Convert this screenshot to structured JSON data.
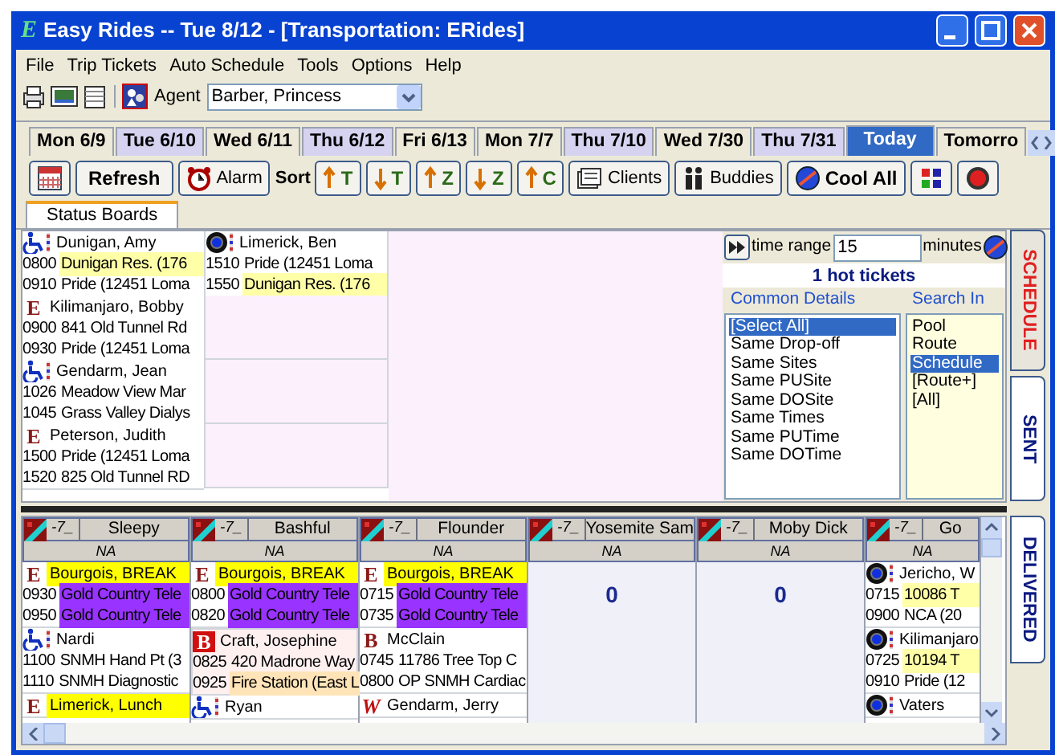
{
  "window": {
    "logo": "E",
    "title": "Easy Rides -- Tue 8/12 - [Transportation: ERides]"
  },
  "menu": [
    "File",
    "Trip Tickets",
    "Auto Schedule",
    "Tools",
    "Options",
    "Help"
  ],
  "agent": {
    "label": "Agent",
    "value": "Barber, Princess"
  },
  "date_tabs": [
    {
      "label": "Mon 6/9",
      "selected": false,
      "color": "#ece9d8"
    },
    {
      "label": "Tue 6/10",
      "selected": false,
      "color": "#d6d3f0"
    },
    {
      "label": "Wed 6/11",
      "selected": false,
      "color": "#ece9d8"
    },
    {
      "label": "Thu 6/12",
      "selected": false,
      "color": "#d6d3f0"
    },
    {
      "label": "Fri 6/13",
      "selected": false,
      "color": "#ece9d8"
    },
    {
      "label": "Mon 7/7",
      "selected": false,
      "color": "#ece9d8"
    },
    {
      "label": "Thu 7/10",
      "selected": false,
      "color": "#d6d3f0"
    },
    {
      "label": "Wed 7/30",
      "selected": false,
      "color": "#ece9d8"
    },
    {
      "label": "Thu 7/31",
      "selected": false,
      "color": "#d6d3f0"
    },
    {
      "label": "Today",
      "selected": true,
      "color": "#316ac5"
    },
    {
      "label": "Tomorro",
      "selected": false,
      "color": "#ece9d8"
    }
  ],
  "toolbar": {
    "refresh": "Refresh",
    "alarm": "Alarm",
    "sort_label": "Sort",
    "sort_buttons": [
      {
        "kind": "up",
        "letter": "T"
      },
      {
        "kind": "down",
        "letter": "T"
      },
      {
        "kind": "up",
        "letter": "Z"
      },
      {
        "kind": "down",
        "letter": "Z"
      },
      {
        "kind": "up",
        "letter": "C"
      }
    ],
    "clients": "Clients",
    "buddies": "Buddies",
    "cool_all": "Cool All"
  },
  "page_tab": "Status Boards",
  "hot_board": {
    "rows": [
      [
        {
          "name": "Dunigan, Amy",
          "kind": "wheelchair",
          "stops": [
            {
              "time": "0800",
              "place": "Dunigan Res. (176",
              "color": "#ffffa8"
            },
            {
              "time": "0910",
              "place": "Pride (12451 Loma"
            }
          ]
        },
        {
          "name": "Limerick, Ben",
          "kind": "target",
          "stops": [
            {
              "time": "1510",
              "place": "Pride (12451 Loma"
            },
            {
              "time": "1550",
              "place": "Dunigan Res. (176",
              "color": "#ffffa8"
            }
          ]
        }
      ],
      [
        {
          "name": "Kilimanjaro, Bobby",
          "kind": "letter",
          "letter": "E",
          "stops": [
            {
              "time": "0900",
              "place": "841 Old Tunnel Rd"
            },
            {
              "time": "0930",
              "place": "Pride (12451 Loma"
            }
          ]
        }
      ],
      [
        {
          "name": "Gendarm, Jean",
          "kind": "wheelchair",
          "stops": [
            {
              "time": "1026",
              "place": "Meadow View Mar"
            },
            {
              "time": "1045",
              "place": "Grass Valley Dialys"
            }
          ]
        }
      ],
      [
        {
          "name": "Peterson, Judith",
          "kind": "letter",
          "letter": "E",
          "stops": [
            {
              "time": "1500",
              "place": "Pride (12451 Loma"
            },
            {
              "time": "1520",
              "place": "825 Old Tunnel RD"
            }
          ]
        }
      ]
    ]
  },
  "filters": {
    "time_range_label": "time range",
    "time_range": "15",
    "minutes_label": "minutes",
    "hot_count": "1 hot tickets",
    "common_details": {
      "title": "Common Details",
      "items": [
        {
          "label": "[Select All]",
          "selected": true
        },
        {
          "label": "Same Drop-off",
          "selected": false
        },
        {
          "label": "Same Sites",
          "selected": false
        },
        {
          "label": "Same PUSite",
          "selected": false
        },
        {
          "label": "Same DOSite",
          "selected": false
        },
        {
          "label": "Same Times",
          "selected": false
        },
        {
          "label": "Same PUTime",
          "selected": false
        },
        {
          "label": "Same DOTime",
          "selected": false
        }
      ]
    },
    "search_in": {
      "title": "Search In",
      "items": [
        {
          "label": "Pool",
          "selected": false
        },
        {
          "label": "Route",
          "selected": false
        },
        {
          "label": "Schedule",
          "selected": true
        },
        {
          "label": "[Route+]",
          "selected": false
        },
        {
          "label": "[All]",
          "selected": false
        }
      ]
    }
  },
  "side_tabs": [
    {
      "label": "SCHEDULE",
      "selected": true
    },
    {
      "label": "SENT",
      "selected": false
    },
    {
      "label": "DELIVERED",
      "selected": false
    }
  ],
  "drivers": [
    {
      "name": "Sleepy",
      "code": "-7_",
      "status": "NA",
      "trips": [
        {
          "name": "Bourgois, BREAK",
          "kind": "letter",
          "letter": "E",
          "color": "#ffff00",
          "flagged": false,
          "stops": [
            {
              "time": "0930",
              "place": "Gold Country Tele",
              "color": "#9933ff"
            },
            {
              "time": "0950",
              "place": "Gold Country Tele",
              "color": "#9933ff"
            }
          ]
        },
        {
          "name": "Nardi",
          "kind": "wheelchair",
          "flagged": false,
          "stops": [
            {
              "time": "1100",
              "place": "SNMH Hand Pt (3"
            },
            {
              "time": "1110",
              "place": "SNMH Diagnostic"
            }
          ]
        },
        {
          "name": "Limerick, Lunch",
          "kind": "letter",
          "letter": "E",
          "color": "#ffff00",
          "flagged": false
        }
      ]
    },
    {
      "name": "Bashful",
      "code": "-7_",
      "status": "NA",
      "trips": [
        {
          "name": "Bourgois, BREAK",
          "kind": "letter",
          "letter": "E",
          "color": "#ffff00",
          "flagged": false,
          "stops": [
            {
              "time": "0800",
              "place": "Gold Country Tele",
              "color": "#9933ff"
            },
            {
              "time": "0820",
              "place": "Gold Country Tele",
              "color": "#9933ff"
            }
          ]
        },
        {
          "name": "Craft, Josephine",
          "kind": "letter-inverse",
          "letter": "B",
          "flagged": true,
          "stops": [
            {
              "time": "0825",
              "place": "420 Madrone Way"
            },
            {
              "time": "0925",
              "place": "Fire Station (East L",
              "color": "#ffe4b8"
            }
          ]
        },
        {
          "name": "Ryan",
          "kind": "wheelchair",
          "flagged": false
        }
      ]
    },
    {
      "name": "Flounder",
      "code": "-7_",
      "status": "NA",
      "trips": [
        {
          "name": "Bourgois, BREAK",
          "kind": "letter",
          "letter": "E",
          "color": "#ffff00",
          "flagged": false,
          "stops": [
            {
              "time": "0715",
              "place": "Gold Country Tele",
              "color": "#9933ff"
            },
            {
              "time": "0735",
              "place": "Gold Country Tele",
              "color": "#9933ff"
            }
          ]
        },
        {
          "name": "McClain",
          "kind": "letter",
          "letter": "B",
          "flagged": false,
          "stops": [
            {
              "time": "0745",
              "place": "11786 Tree Top C"
            },
            {
              "time": "0800",
              "place": "OP SNMH Cardiac"
            }
          ]
        },
        {
          "name": "Gendarm, Jerry",
          "kind": "letter-italic",
          "letter": "W",
          "flagged": false
        }
      ]
    },
    {
      "name": "Yosemite Sam",
      "code": "-7_",
      "status": "NA",
      "count": "0"
    },
    {
      "name": "Moby Dick",
      "code": "-7_",
      "status": "NA",
      "count": "0"
    },
    {
      "name": "Go",
      "code": "-7_",
      "status": "NA",
      "trips": [
        {
          "name": "Jericho, W",
          "kind": "target",
          "flagged": false,
          "stops": [
            {
              "time": "0715",
              "place": "10086 T",
              "color": "#ffffa8"
            },
            {
              "time": "0900",
              "place": "NCA (20"
            }
          ]
        },
        {
          "name": "Kilimanjaro",
          "kind": "target",
          "flagged": false,
          "stops": [
            {
              "time": "0725",
              "place": "10194 T",
              "color": "#ffffa8"
            },
            {
              "time": "0910",
              "place": "Pride (12"
            }
          ]
        },
        {
          "name": "Vaters",
          "kind": "target",
          "flagged": false
        }
      ]
    }
  ]
}
